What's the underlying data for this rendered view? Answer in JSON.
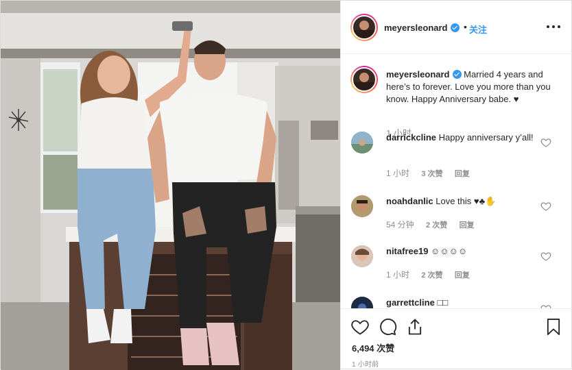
{
  "post": {
    "author": "meyersleonard",
    "follow_label": "关注",
    "dot": "•",
    "caption": "Married 4 years and here’s to forever. Love you more than you know. Happy Anniversary babe. ♥",
    "caption_time": "1 小时",
    "likes": "6,494 次赞",
    "ago": "1 小时前"
  },
  "comments": [
    {
      "user": "darrickcline",
      "text": "Happy anniversary y’all!",
      "time": "1 小时",
      "likes": "3 次赞",
      "reply": "回复"
    },
    {
      "user": "noahdanlic",
      "text": "Love this ♥♣✋",
      "time": "54 分钟",
      "likes": "2 次赞",
      "reply": "回复"
    },
    {
      "user": "nitafree19",
      "text": "☺☺☺☺",
      "time": "1 小时",
      "likes": "2 次赞",
      "reply": "回复"
    },
    {
      "user": "garrettcline",
      "text": "□□",
      "time": "",
      "likes": "",
      "reply": ""
    }
  ],
  "icons": {
    "verified": "verified-badge-icon",
    "more": "more-options-icon",
    "heart": "heart-icon",
    "comment": "comment-icon",
    "share": "share-icon",
    "save": "bookmark-icon"
  },
  "colors": {
    "accent": "#3897f0",
    "muted": "#8e8e8e",
    "text": "#262626"
  }
}
